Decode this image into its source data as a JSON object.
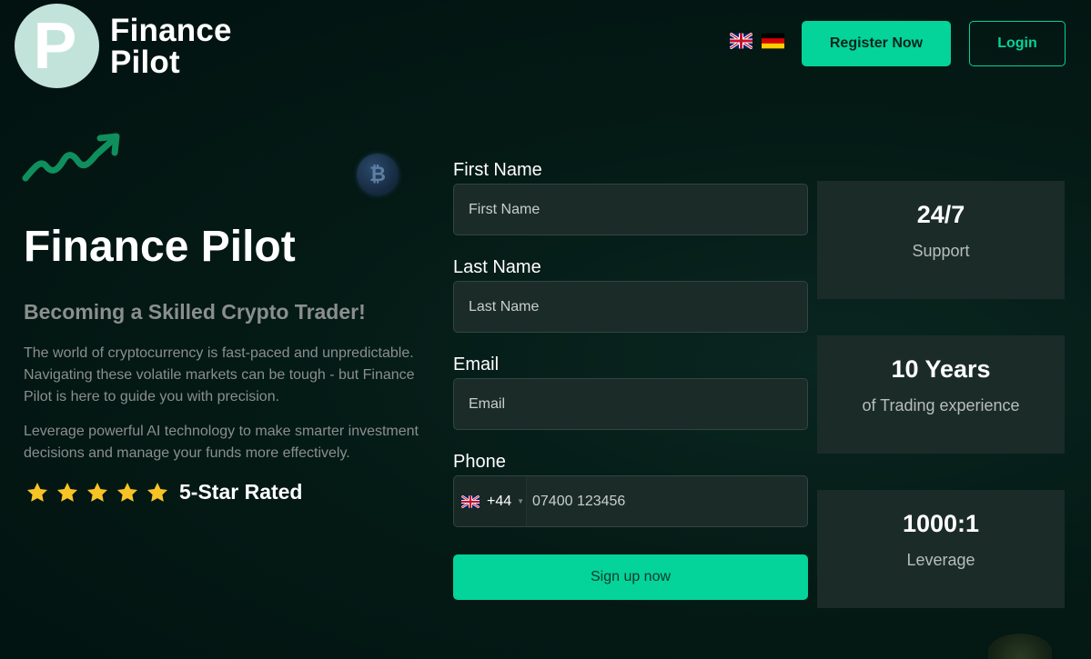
{
  "brand": {
    "logo_letter": "P",
    "name_line1": "Finance",
    "name_line2": "Pilot"
  },
  "header": {
    "languages": [
      "english-flag",
      "german-flag"
    ],
    "register_label": "Register Now",
    "login_label": "Login"
  },
  "hero": {
    "title": "Finance Pilot",
    "subtitle": "Becoming a Skilled Crypto Trader!",
    "paragraph1": "The world of cryptocurrency is fast-paced and unpredictable. Navigating these volatile markets can be tough - but Finance Pilot is here to guide you with precision.",
    "paragraph2": "Leverage powerful AI technology to make smarter investment decisions and manage your funds more effectively.",
    "rating_stars": 5,
    "rating_label": "5-Star Rated"
  },
  "form": {
    "first_name_label": "First Name",
    "first_name_placeholder": "First Name",
    "last_name_label": "Last Name",
    "last_name_placeholder": "Last Name",
    "email_label": "Email",
    "email_placeholder": "Email",
    "phone_label": "Phone",
    "phone_country_code": "+44",
    "phone_placeholder": "07400 123456",
    "submit_label": "Sign up now"
  },
  "stats": [
    {
      "value": "24/7",
      "label": "Support"
    },
    {
      "value": "10 Years",
      "label": "of Trading experience"
    },
    {
      "value": "1000:1",
      "label": "Leverage"
    }
  ],
  "colors": {
    "accent": "#04d39a",
    "background": "#031612",
    "card": "#1b2c28",
    "muted_text": "#8a8f8d",
    "star": "#f7c325"
  }
}
